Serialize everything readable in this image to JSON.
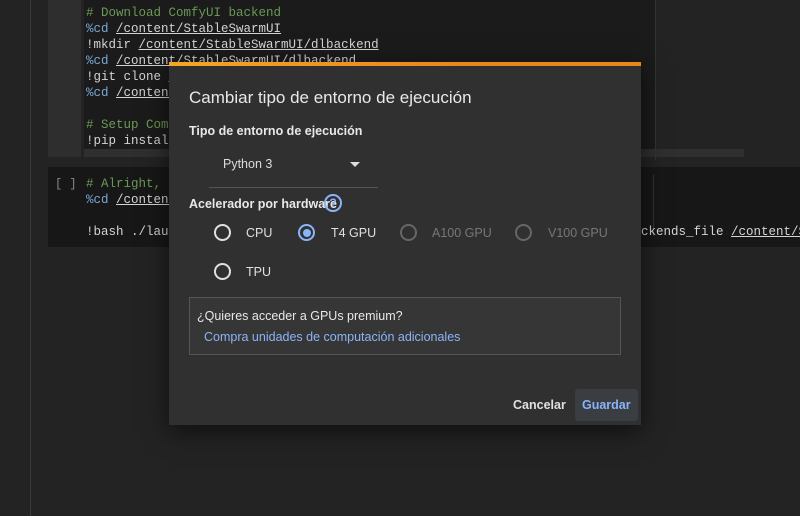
{
  "notebook": {
    "cell1_lines": [
      {
        "kind": "comment",
        "text": "# Download ComfyUI backend"
      },
      {
        "kind": "magic",
        "cmd": "%cd",
        "arg": "/content/StableSwarmUI"
      },
      {
        "kind": "bang",
        "cmd": "!mkdir",
        "arg": "/content/StableSwarmUI/dlbackend"
      },
      {
        "kind": "magic",
        "cmd": "%cd",
        "arg": "/content/StableSwarmUI/dlbackend"
      },
      {
        "kind": "bang",
        "cmd": "!git clone",
        "arg": "h"
      },
      {
        "kind": "magic",
        "cmd": "%cd",
        "arg": "/content"
      },
      {
        "kind": "blank"
      },
      {
        "kind": "comment",
        "text": "# Setup Comf"
      },
      {
        "kind": "bang",
        "cmd": "!pip install",
        "arg": ""
      }
    ],
    "cell2_run_indicator": "[ ]",
    "cell2_lines": [
      {
        "kind": "comment",
        "text": "# Alright, l"
      },
      {
        "kind": "magic",
        "cmd": "%cd",
        "arg": "/content"
      },
      {
        "kind": "blank"
      },
      {
        "kind": "bang",
        "cmd": "!bash ./laun",
        "arg": ""
      }
    ],
    "cell2_line4_tail": "ckends_file",
    "cell2_line4_tail_path": "/content/S"
  },
  "dialog": {
    "title": "Cambiar tipo de entorno de ejecución",
    "runtime_label": "Tipo de entorno de ejecución",
    "runtime_value": "Python 3",
    "accelerator_label": "Acelerador por hardware",
    "help_icon": "?",
    "options": [
      {
        "label": "CPU",
        "selected": false,
        "disabled": false
      },
      {
        "label": "T4 GPU",
        "selected": true,
        "disabled": false
      },
      {
        "label": "A100 GPU",
        "selected": false,
        "disabled": true
      },
      {
        "label": "V100 GPU",
        "selected": false,
        "disabled": true
      },
      {
        "label": "TPU",
        "selected": false,
        "disabled": false
      }
    ],
    "premium_question": "¿Quieres acceder a GPUs premium?",
    "premium_link": "Compra unidades de computación adicionales",
    "cancel": "Cancelar",
    "save": "Guardar",
    "accent_color": "#8ab4f8",
    "top_bar_color": "#e8871e"
  }
}
